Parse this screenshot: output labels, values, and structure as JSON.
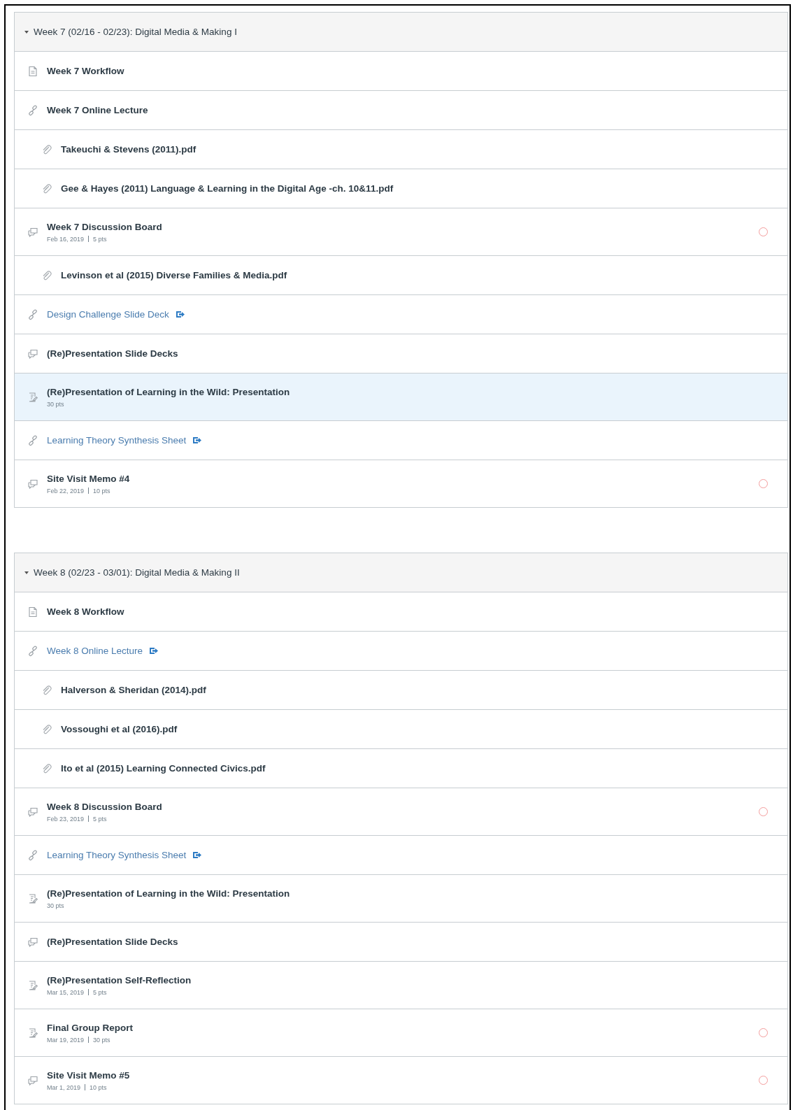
{
  "modules": [
    {
      "title": "Week 7 (02/16 - 02/23): Digital Media & Making I",
      "expanded": true,
      "items": [
        {
          "kind": "page",
          "title": "Week 7 Workflow",
          "selected": false,
          "pending": false
        },
        {
          "kind": "link",
          "title": "Week 7 Online Lecture",
          "external": false,
          "selected": false,
          "pending": false
        },
        {
          "kind": "attachment",
          "title": "Takeuchi & Stevens (2011).pdf",
          "selected": false,
          "pending": false
        },
        {
          "kind": "attachment",
          "title": "Gee & Hayes (2011) Language & Learning in the Digital Age -ch. 10&11.pdf",
          "selected": false,
          "pending": false
        },
        {
          "kind": "discussion",
          "title": "Week 7 Discussion Board",
          "date": "Feb 16, 2019",
          "points": "5 pts",
          "selected": false,
          "pending": true
        },
        {
          "kind": "attachment",
          "title": "Levinson et al (2015) Diverse Families & Media.pdf",
          "selected": false,
          "pending": false
        },
        {
          "kind": "link",
          "title": "Design Challenge Slide Deck",
          "external": true,
          "selected": false,
          "pending": false
        },
        {
          "kind": "discussion",
          "title": "(Re)Presentation Slide Decks",
          "selected": false,
          "pending": false
        },
        {
          "kind": "assignment",
          "title": "(Re)Presentation of Learning in the Wild: Presentation",
          "points": "30 pts",
          "selected": true,
          "pending": false
        },
        {
          "kind": "link",
          "title": "Learning Theory Synthesis Sheet",
          "external": true,
          "selected": false,
          "pending": false
        },
        {
          "kind": "discussion",
          "title": "Site Visit Memo #4",
          "date": "Feb 22, 2019",
          "points": "10 pts",
          "selected": false,
          "pending": true
        }
      ]
    },
    {
      "title": "Week 8 (02/23 - 03/01): Digital Media & Making II",
      "expanded": true,
      "items": [
        {
          "kind": "page",
          "title": "Week 8 Workflow",
          "selected": false,
          "pending": false
        },
        {
          "kind": "link",
          "title": "Week 8 Online Lecture",
          "external": true,
          "selected": false,
          "pending": false
        },
        {
          "kind": "attachment",
          "title": "Halverson & Sheridan (2014).pdf",
          "selected": false,
          "pending": false
        },
        {
          "kind": "attachment",
          "title": "Vossoughi et al (2016).pdf",
          "selected": false,
          "pending": false
        },
        {
          "kind": "attachment",
          "title": "Ito et al (2015) Learning Connected Civics.pdf",
          "selected": false,
          "pending": false
        },
        {
          "kind": "discussion",
          "title": "Week 8 Discussion Board",
          "date": "Feb 23, 2019",
          "points": "5 pts",
          "selected": false,
          "pending": true
        },
        {
          "kind": "link",
          "title": "Learning Theory Synthesis Sheet",
          "external": true,
          "selected": false,
          "pending": false
        },
        {
          "kind": "assignment",
          "title": "(Re)Presentation of Learning in the Wild: Presentation",
          "points": "30 pts",
          "selected": false,
          "pending": false
        },
        {
          "kind": "discussion",
          "title": "(Re)Presentation Slide Decks",
          "selected": false,
          "pending": false
        },
        {
          "kind": "assignment",
          "title": "(Re)Presentation Self-Reflection",
          "date": "Mar 15, 2019",
          "points": "5 pts",
          "selected": false,
          "pending": false
        },
        {
          "kind": "assignment",
          "title": "Final Group Report",
          "date": "Mar 19, 2019",
          "points": "30 pts",
          "selected": false,
          "pending": true
        },
        {
          "kind": "discussion",
          "title": "Site Visit Memo #5",
          "date": "Mar 1, 2019",
          "points": "10 pts",
          "selected": false,
          "pending": true
        }
      ]
    }
  ]
}
